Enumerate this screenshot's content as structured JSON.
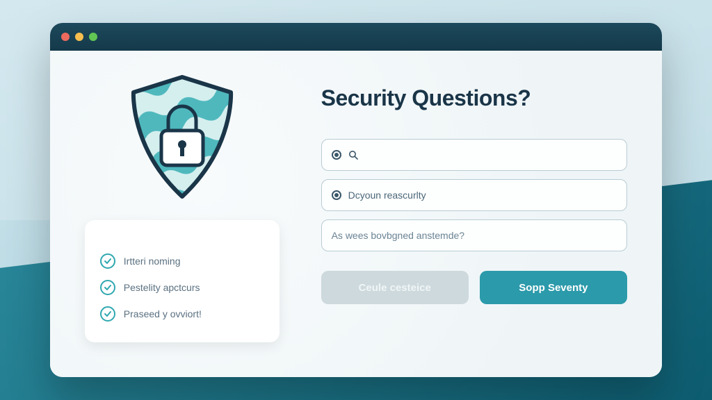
{
  "heading": "Security Questions?",
  "fields": {
    "option1": "",
    "option2": "Dcyoun reascurlty",
    "input3_placeholder": "As wees bovbgned anstemde?"
  },
  "checklist": {
    "items": [
      {
        "label": "Irtteri noming"
      },
      {
        "label": "Pestelity apctcurs"
      },
      {
        "label": "Praseed y ovviort!"
      }
    ]
  },
  "buttons": {
    "secondary": "Ceule cesteice",
    "primary": "Sopp Seventy"
  },
  "colors": {
    "accent": "#2b9aaa",
    "text_dark": "#1a3548"
  }
}
